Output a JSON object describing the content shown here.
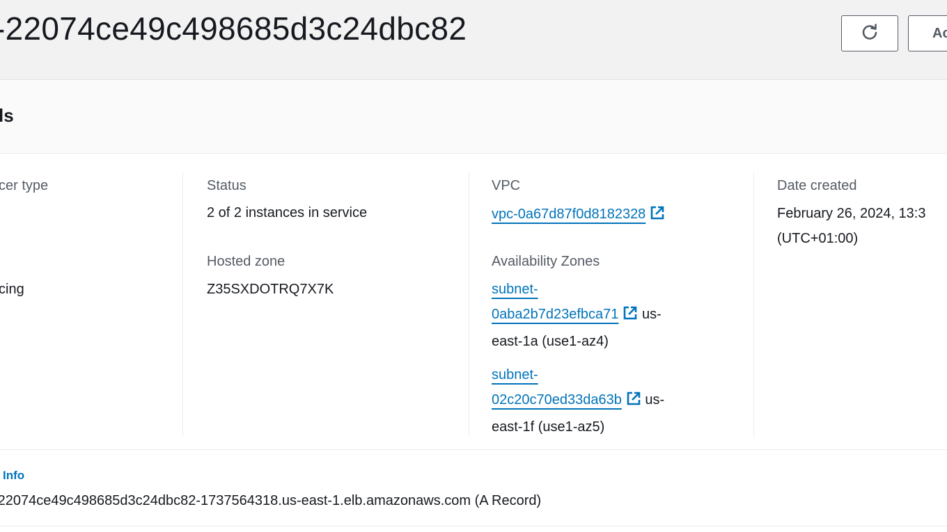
{
  "header": {
    "title": "-22074ce49c498685d3c24dbc82",
    "refresh_icon": "refresh-icon",
    "actions_label": "Ac"
  },
  "details": {
    "title": "ls"
  },
  "col1": {
    "type_label": "cer type",
    "scheme_value": "cing"
  },
  "col2": {
    "status_label": "Status",
    "status_value": "2 of 2 instances in service",
    "hosted_zone_label": "Hosted zone",
    "hosted_zone_value": "Z35SXDOTRQ7X7K"
  },
  "col3": {
    "vpc_label": "VPC",
    "vpc_value": "vpc-0a67d87f0d8182328",
    "az_label": "Availability Zones",
    "subnets": [
      {
        "line1": "subnet-",
        "line2": "0aba2b7d23efbca71",
        "suffix": "us-",
        "line3": "east-1a (use1-az4)"
      },
      {
        "line1": "subnet-",
        "line2": "02c20c70ed33da63b",
        "suffix": "us-",
        "line3": "east-1f (use1-az5)"
      }
    ]
  },
  "col4": {
    "date_label": "Date created",
    "date_value_line1": "February 26, 2024, 13:3",
    "date_value_line2": "(UTC+01:00)"
  },
  "dns": {
    "info_label": "Info",
    "value": "-22074ce49c498685d3c24dbc82-1737564318.us-east-1.elb.amazonaws.com (A Record)"
  },
  "colors": {
    "link": "#0073bb",
    "text": "#16191f",
    "label": "#545b64",
    "header_bg": "#f2f2f2"
  }
}
